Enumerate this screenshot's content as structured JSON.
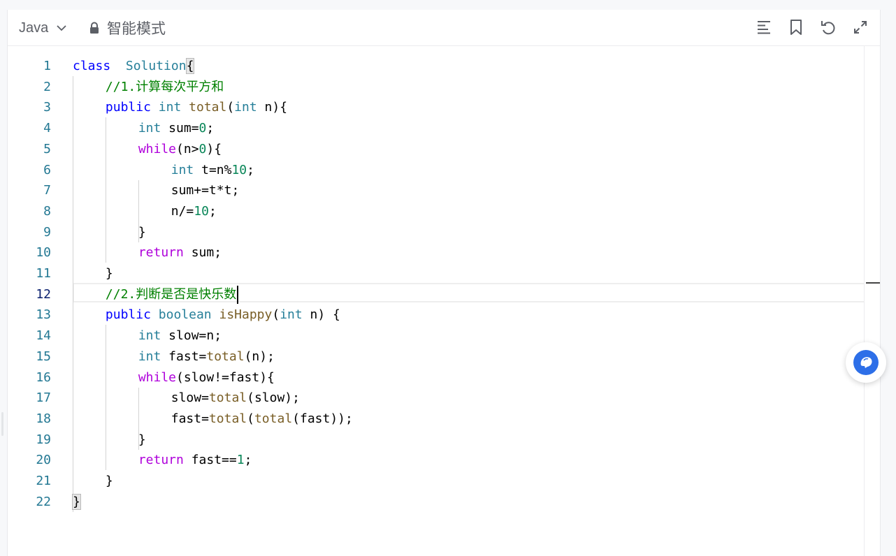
{
  "toolbar": {
    "language": "Java",
    "mode_label": "智能模式",
    "icons": [
      "format-icon",
      "bookmark-icon",
      "undo-icon",
      "fullscreen-icon"
    ]
  },
  "editor": {
    "current_line": 12,
    "lines": [
      {
        "n": "1",
        "tokens": [
          [
            "kw",
            "class"
          ],
          [
            "",
            "  "
          ],
          [
            "ty",
            "Solution"
          ],
          [
            "",
            ""
          ],
          [
            "brk",
            "{"
          ]
        ]
      },
      {
        "n": "2",
        "tokens": [
          [
            "cmt",
            "//1.计算每次平方和"
          ]
        ]
      },
      {
        "n": "3",
        "tokens": [
          [
            "kw",
            "public"
          ],
          [
            "",
            " "
          ],
          [
            "ty",
            "int"
          ],
          [
            "",
            " "
          ],
          [
            "fn",
            "total"
          ],
          [
            "",
            "("
          ],
          [
            "ty",
            "int"
          ],
          [
            "",
            " n){"
          ]
        ]
      },
      {
        "n": "4",
        "tokens": [
          [
            "ty",
            "int"
          ],
          [
            "",
            " sum="
          ],
          [
            "num",
            "0"
          ],
          [
            "",
            ";"
          ]
        ]
      },
      {
        "n": "5",
        "tokens": [
          [
            "ctl",
            "while"
          ],
          [
            "",
            "(n>"
          ],
          [
            "num",
            "0"
          ],
          [
            "",
            "){"
          ]
        ]
      },
      {
        "n": "6",
        "tokens": [
          [
            "ty",
            "int"
          ],
          [
            "",
            " t=n%"
          ],
          [
            "num",
            "10"
          ],
          [
            "",
            ";"
          ]
        ]
      },
      {
        "n": "7",
        "tokens": [
          [
            "",
            "sum+=t*t;"
          ]
        ]
      },
      {
        "n": "8",
        "tokens": [
          [
            "",
            "n/="
          ],
          [
            "num",
            "10"
          ],
          [
            "",
            ";"
          ]
        ]
      },
      {
        "n": "9",
        "tokens": [
          [
            "",
            "}"
          ]
        ]
      },
      {
        "n": "10",
        "tokens": [
          [
            "ctl",
            "return"
          ],
          [
            "",
            " sum;"
          ]
        ]
      },
      {
        "n": "11",
        "tokens": [
          [
            "",
            "}"
          ]
        ]
      },
      {
        "n": "12",
        "tokens": [
          [
            "cmt",
            "//2.判断是否是快乐数"
          ]
        ]
      },
      {
        "n": "13",
        "tokens": [
          [
            "kw",
            "public"
          ],
          [
            "",
            " "
          ],
          [
            "ty",
            "boolean"
          ],
          [
            "",
            " "
          ],
          [
            "fn",
            "isHappy"
          ],
          [
            "",
            "("
          ],
          [
            "ty",
            "int"
          ],
          [
            "",
            " n) {"
          ]
        ]
      },
      {
        "n": "14",
        "tokens": [
          [
            "ty",
            "int"
          ],
          [
            "",
            " slow=n;"
          ]
        ]
      },
      {
        "n": "15",
        "tokens": [
          [
            "ty",
            "int"
          ],
          [
            "",
            " fast="
          ],
          [
            "fn",
            "total"
          ],
          [
            "",
            "(n);"
          ]
        ]
      },
      {
        "n": "16",
        "tokens": [
          [
            "ctl",
            "while"
          ],
          [
            "",
            "(slow!=fast){"
          ]
        ]
      },
      {
        "n": "17",
        "tokens": [
          [
            "",
            "slow="
          ],
          [
            "fn",
            "total"
          ],
          [
            "",
            "(slow);"
          ]
        ]
      },
      {
        "n": "18",
        "tokens": [
          [
            "",
            "fast="
          ],
          [
            "fn",
            "total"
          ],
          [
            "",
            "("
          ],
          [
            "fn",
            "total"
          ],
          [
            "",
            "(fast));"
          ]
        ]
      },
      {
        "n": "19",
        "tokens": [
          [
            "",
            "}"
          ]
        ]
      },
      {
        "n": "20",
        "tokens": [
          [
            "ctl",
            "return"
          ],
          [
            "",
            " fast=="
          ],
          [
            "num",
            "1"
          ],
          [
            "",
            ";"
          ]
        ]
      },
      {
        "n": "21",
        "tokens": [
          [
            "",
            "}"
          ]
        ]
      },
      {
        "n": "22",
        "tokens": [
          [
            "brk",
            "}"
          ]
        ]
      }
    ]
  },
  "colors": {
    "keyword": "#0000ff",
    "type": "#267f99",
    "function": "#795e26",
    "control": "#af00db",
    "number": "#098658",
    "comment": "#008000",
    "fab_accent": "#2d6fe8"
  }
}
